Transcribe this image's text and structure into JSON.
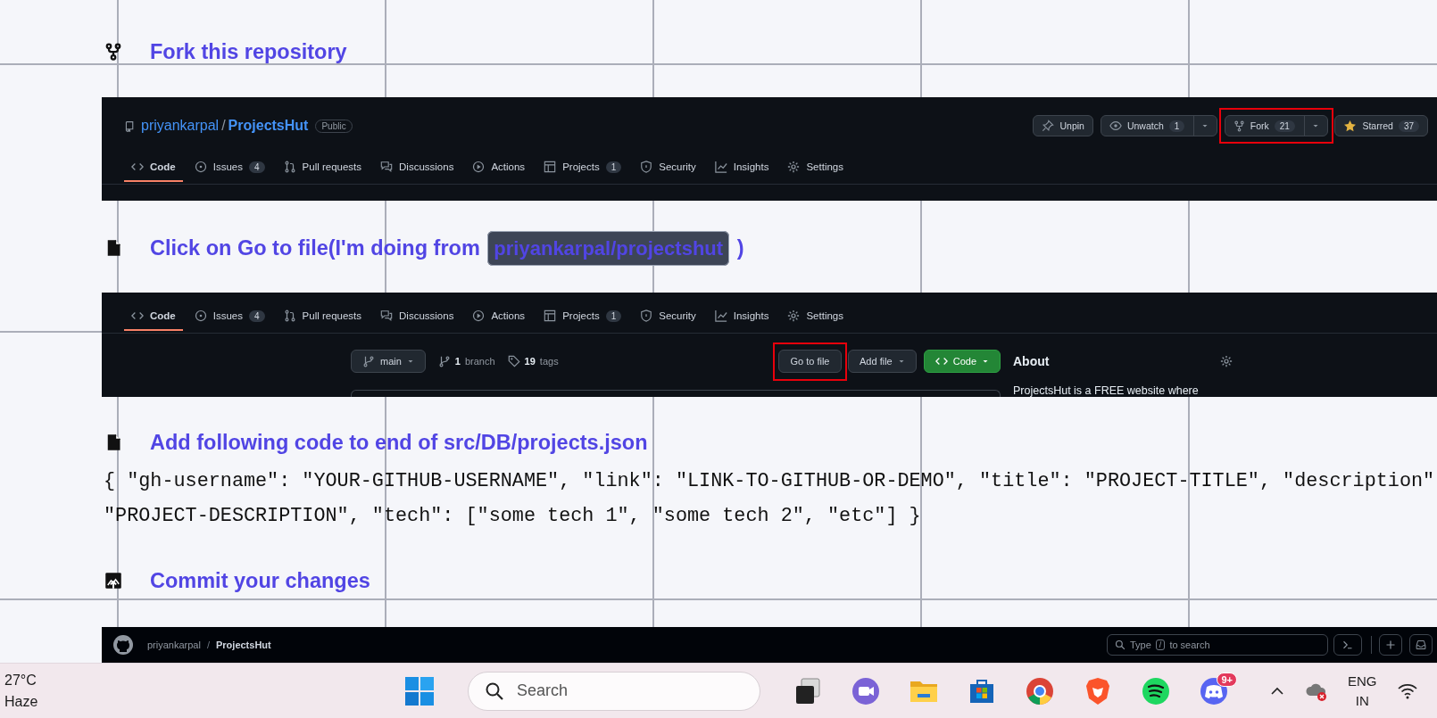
{
  "sections": [
    {
      "kind": "step",
      "text": "Fork this repository"
    },
    {
      "kind": "repo_header",
      "owner": "priyankarpal",
      "separator": "/",
      "repo": "ProjectsHut",
      "visibility": "Public",
      "actions": [
        {
          "label": "Unpin",
          "highlighted": false
        },
        {
          "label": "Unwatch",
          "count": "1",
          "dropdown": true,
          "highlighted": false
        },
        {
          "label": "Fork",
          "count": "21",
          "dropdown": true,
          "highlighted": true
        },
        {
          "label": "Starred",
          "count": "37",
          "highlighted": false
        }
      ],
      "tabs": [
        {
          "label": "Code",
          "selected": true
        },
        {
          "label": "Issues",
          "count": "4",
          "selected": false
        },
        {
          "label": "Pull requests",
          "selected": false
        },
        {
          "label": "Discussions",
          "selected": false
        },
        {
          "label": "Actions",
          "selected": false
        },
        {
          "label": "Projects",
          "count": "1",
          "selected": false
        },
        {
          "label": "Security",
          "selected": false
        },
        {
          "label": "Insights",
          "selected": false
        },
        {
          "label": "Settings",
          "selected": false
        }
      ]
    },
    {
      "kind": "step",
      "text": "Click on Go to file(I'm doing from ",
      "link": "priyankarpal/projectshut",
      "tail": " )"
    },
    {
      "kind": "repo_code",
      "tabs": [
        {
          "label": "Code",
          "selected": true
        },
        {
          "label": "Issues",
          "count": "4",
          "selected": false
        },
        {
          "label": "Pull requests",
          "selected": false
        },
        {
          "label": "Discussions",
          "selected": false
        },
        {
          "label": "Actions",
          "selected": false
        },
        {
          "label": "Projects",
          "count": "1",
          "selected": false
        },
        {
          "label": "Security",
          "selected": false
        },
        {
          "label": "Insights",
          "selected": false
        },
        {
          "label": "Settings",
          "selected": false
        }
      ],
      "branch": "main",
      "branch_count": "1",
      "branch_label": "branch",
      "tag_count": "19",
      "tag_label": "tags",
      "buttons": [
        {
          "label": "Go to file",
          "kind": "plain",
          "highlighted": true
        },
        {
          "label": "Add file",
          "kind": "dropdown",
          "highlighted": false
        },
        {
          "label": "Code",
          "kind": "primary",
          "highlighted": false
        }
      ],
      "about_title": "About",
      "about_text": "ProjectsHut is a FREE website where"
    },
    {
      "kind": "step",
      "text": "Add following code to end of  src/DB/projects.json"
    },
    {
      "kind": "code",
      "lines": [
        "{ \"gh-username\": \"YOUR-GITHUB-USERNAME\", \"link\": \"LINK-TO-GITHUB-OR-DEMO\", \"title\": \"PROJECT-TITLE\", \"description\"",
        "\"PROJECT-DESCRIPTION\", \"tech\": [\"some tech 1\", \"some tech 2\", \"etc\"] }"
      ]
    },
    {
      "kind": "step",
      "text": "Commit your changes"
    },
    {
      "kind": "page_header",
      "owner": "priyankarpal",
      "separator": "/",
      "repo": "ProjectsHut",
      "search_prefix": "Type",
      "search_key": "/",
      "search_suffix": "to search"
    }
  ],
  "taskbar": {
    "temperature": "27°C",
    "condition": "Haze",
    "search_placeholder": "Search",
    "apps": [
      {
        "kind": "start"
      },
      {
        "kind": "taskview"
      },
      {
        "kind": "meet"
      },
      {
        "kind": "folder"
      },
      {
        "kind": "store"
      },
      {
        "kind": "browser"
      },
      {
        "kind": "shield"
      },
      {
        "kind": "music"
      },
      {
        "kind": "chat",
        "badge": "9+"
      }
    ],
    "language": "ENG",
    "region": "IN"
  }
}
